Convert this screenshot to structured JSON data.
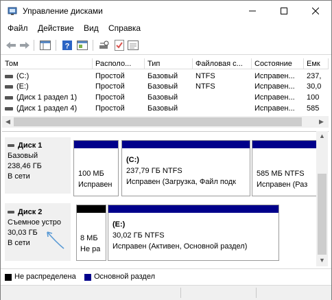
{
  "window": {
    "title": "Управление дисками"
  },
  "menu": [
    "Файл",
    "Действие",
    "Вид",
    "Справка"
  ],
  "table": {
    "columns": [
      "Том",
      "Располо...",
      "Тип",
      "Файловая с...",
      "Состояние",
      "Емк"
    ],
    "rows": [
      [
        "(C:)",
        "Простой",
        "Базовый",
        "NTFS",
        "Исправен...",
        "237,"
      ],
      [
        "(E:)",
        "Простой",
        "Базовый",
        "NTFS",
        "Исправен...",
        "30,0"
      ],
      [
        "(Диск 1 раздел 1)",
        "Простой",
        "Базовый",
        "",
        "Исправен...",
        "100"
      ],
      [
        "(Диск 1 раздел 4)",
        "Простой",
        "Базовый",
        "",
        "Исправен...",
        "585"
      ]
    ]
  },
  "disks": [
    {
      "name": "Диск 1",
      "type": "Базовый",
      "size": "238,46 ГБ",
      "status": "В сети",
      "partitions": [
        {
          "line1": "",
          "line2": "100 МБ",
          "line3": "Исправен"
        },
        {
          "line1": "(C:)",
          "line2": "237,79 ГБ NTFS",
          "line3": "Исправен (Загрузка, Файл подк"
        },
        {
          "line1": "",
          "line2": "585 МБ NTFS",
          "line3": "Исправен (Раз"
        }
      ]
    },
    {
      "name": "Диск 2",
      "type": "Съемное устро",
      "size": "30,03 ГБ",
      "status": "В сети",
      "partitions": [
        {
          "line1": "",
          "line2": "8 МБ",
          "line3": "Не ра"
        },
        {
          "line1": "(E:)",
          "line2": "30,02 ГБ NTFS",
          "line3": "Исправен (Активен, Основной раздел)"
        }
      ]
    }
  ],
  "legend": [
    {
      "label": "Не распределена",
      "color": "#000000"
    },
    {
      "label": "Основной раздел",
      "color": "#00008b"
    }
  ],
  "colors": {
    "primary": "#00008b",
    "unallocated": "#000000",
    "arrow": "#5b9bd5"
  }
}
